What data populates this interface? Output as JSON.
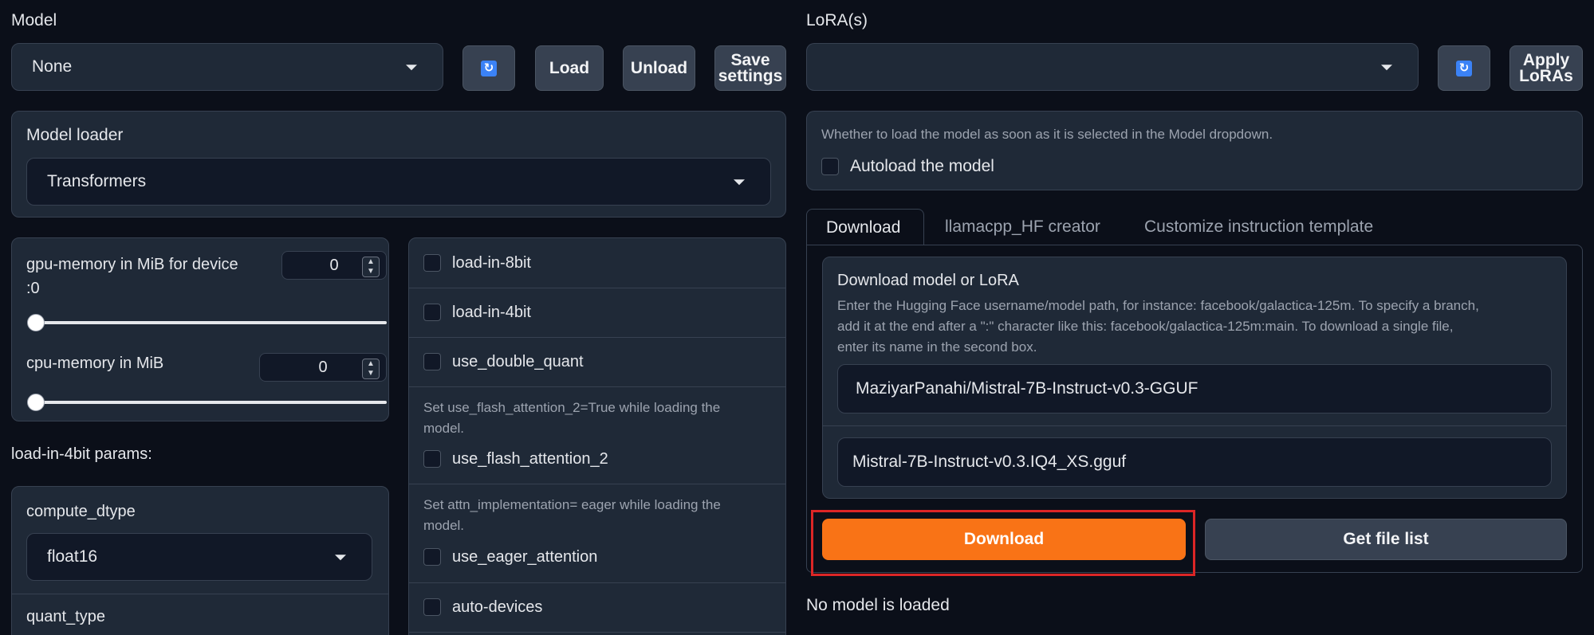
{
  "left": {
    "model_label": "Model",
    "model_value": "None",
    "load_label": "Load",
    "unload_label": "Unload",
    "save_settings_line1": "Save",
    "save_settings_line2": "settings",
    "model_loader_label": "Model loader",
    "model_loader_value": "Transformers",
    "gpu_memory_label_line1": "gpu-memory in MiB for device",
    "gpu_memory_label_line2": ":0",
    "gpu_memory_value": "0",
    "cpu_memory_label": "cpu-memory in MiB",
    "cpu_memory_value": "0",
    "load_4bit_params_label": "load-in-4bit params:",
    "compute_dtype_label": "compute_dtype",
    "compute_dtype_value": "float16",
    "quant_type_label": "quant_type"
  },
  "options": {
    "load_in_8bit": "load-in-8bit",
    "load_in_4bit": "load-in-4bit",
    "use_double_quant": "use_double_quant",
    "flash_info_line1": "Set use_flash_attention_2=True while loading the",
    "flash_info_line2": "model.",
    "use_flash_attention_2": "use_flash_attention_2",
    "eager_info_line1": "Set attn_implementation= eager while loading the",
    "eager_info_line2": "model.",
    "use_eager_attention": "use_eager_attention",
    "auto_devices": "auto-devices"
  },
  "right": {
    "lora_label": "LoRA(s)",
    "apply_loras_line1": "Apply",
    "apply_loras_line2": "LoRAs",
    "autoload_info": "Whether to load the model as soon as it is selected in the Model dropdown.",
    "autoload_label": "Autoload the model",
    "tabs": [
      "Download",
      "llamacpp_HF creator",
      "Customize instruction template"
    ],
    "download_title": "Download model or LoRA",
    "download_desc_line1": "Enter the Hugging Face username/model path, for instance: facebook/galactica-125m. To specify a branch,",
    "download_desc_line2": "add it at the end after a \":\" character like this: facebook/galactica-125m:main. To download a single file,",
    "download_desc_line3": "enter its name in the second box.",
    "model_path_value": "MaziyarPanahi/Mistral-7B-Instruct-v0.3-GGUF",
    "file_name_value": "Mistral-7B-Instruct-v0.3.IQ4_XS.gguf",
    "download_button": "Download",
    "get_file_list_button": "Get file list",
    "status_text": "No model is loaded"
  },
  "colors": {
    "accent_orange": "#f97316",
    "highlight_red": "#dc2626",
    "background": "#0b0f19",
    "panel": "#1f2937"
  },
  "icons": {
    "refresh": "refresh-icon",
    "dropdown": "chevron-down-icon"
  }
}
